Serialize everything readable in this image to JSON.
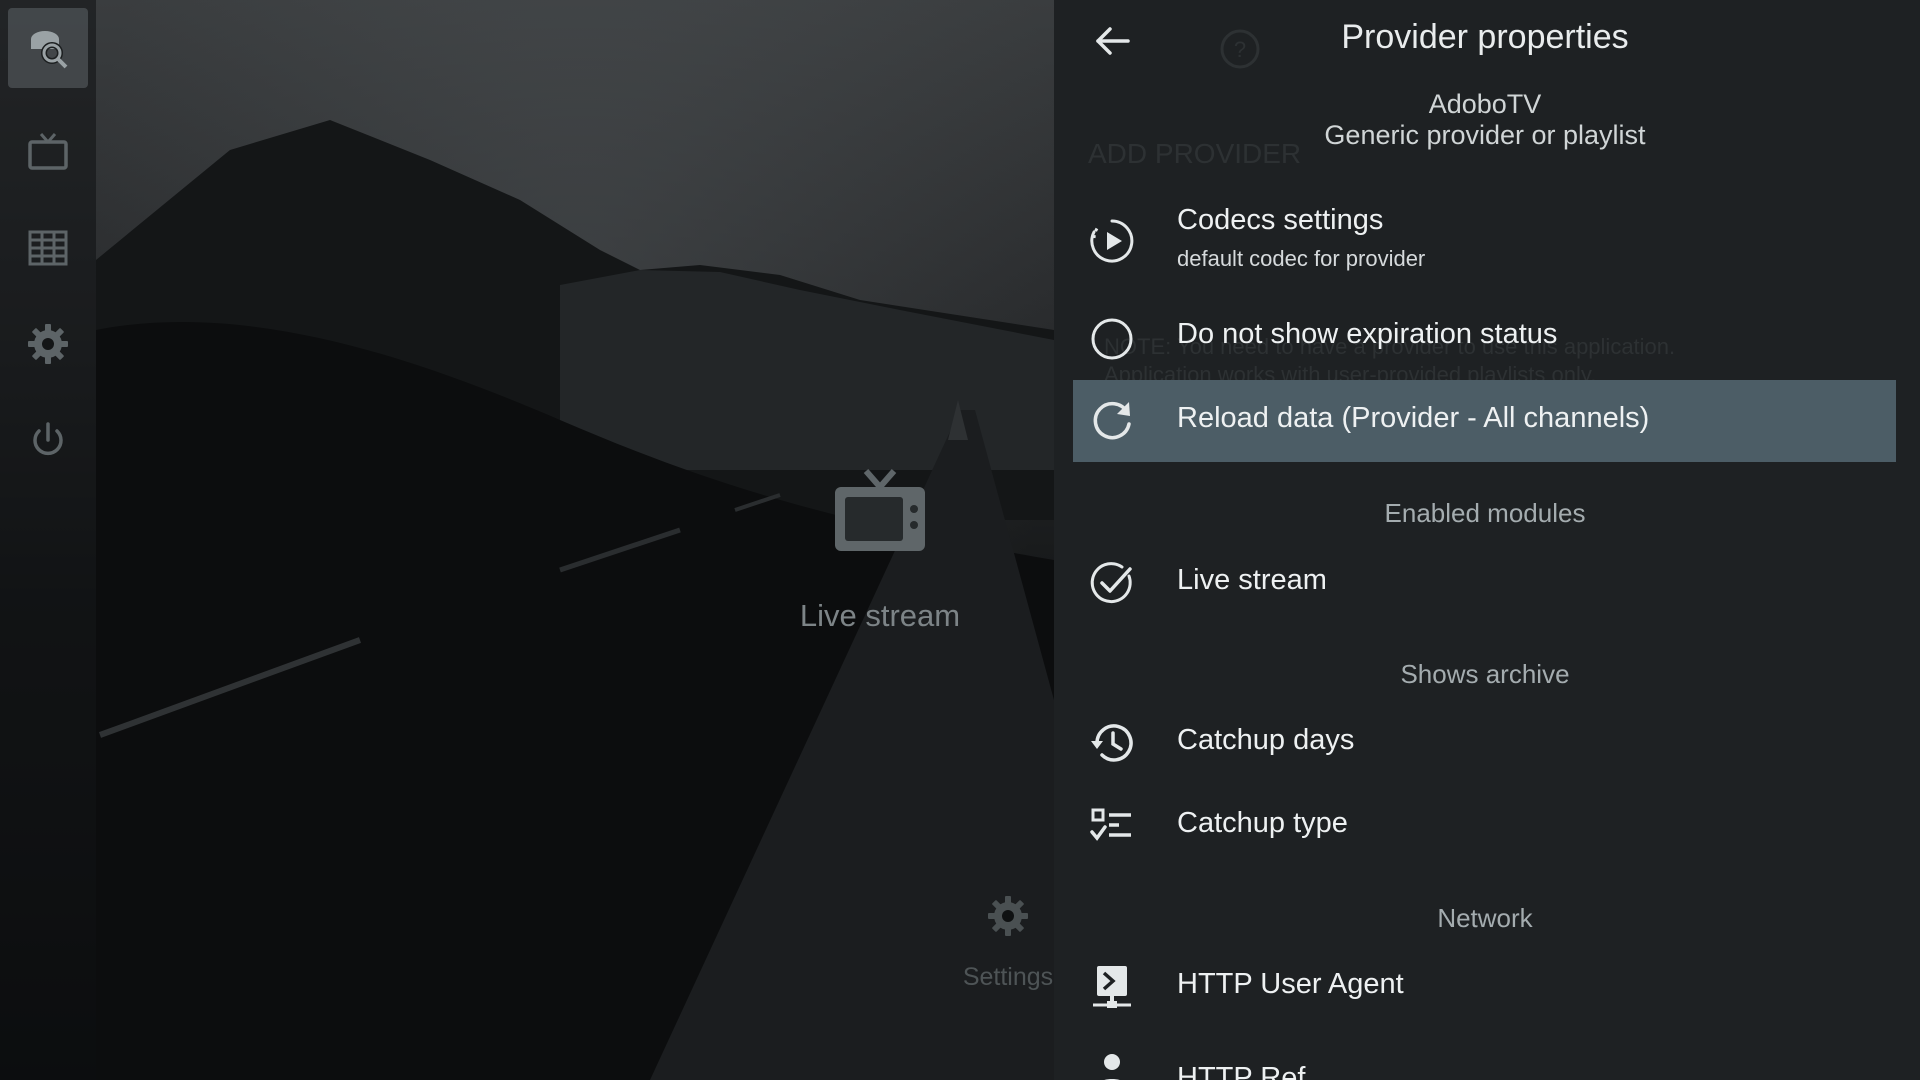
{
  "rail": {
    "items": [
      {
        "name": "search-channels",
        "icon": "search-icon",
        "active": true
      },
      {
        "name": "tv",
        "icon": "tv-icon",
        "active": false
      },
      {
        "name": "guide",
        "icon": "grid-icon",
        "active": false
      },
      {
        "name": "settings",
        "icon": "gear-icon",
        "active": false
      },
      {
        "name": "power",
        "icon": "power-icon",
        "active": false
      }
    ]
  },
  "background": {
    "feature_label": "Live stream",
    "settings_label": "Settings",
    "ghost_add_provider": "ADD PROVIDER",
    "ghost_note": "NOTE: You need to have a provider to use this application.",
    "ghost_note2": "Application works with user-provided playlists only."
  },
  "dialog": {
    "title": "Provider properties",
    "provider_name": "AdoboTV",
    "provider_type": "Generic provider or playlist",
    "rows": {
      "codecs": {
        "label": "Codecs settings",
        "sub": "default codec for provider",
        "icon": "play-circle-icon"
      },
      "expiration": {
        "label": "Do not show expiration status",
        "icon": "radio-unchecked-icon"
      },
      "reload": {
        "label": "Reload data (Provider - All channels)",
        "icon": "refresh-icon",
        "selected": true
      },
      "live_stream": {
        "label": "Live stream",
        "icon": "check-circle-icon"
      },
      "catchup_days": {
        "label": "Catchup days",
        "icon": "history-icon"
      },
      "catchup_type": {
        "label": "Catchup type",
        "icon": "list-check-icon"
      },
      "http_user_agent": {
        "label": "HTTP User Agent",
        "icon": "agent-icon"
      },
      "http_referer_partial": {
        "label": "HTTP Ref",
        "icon": "person-icon"
      }
    },
    "sections": {
      "enabled_modules": "Enabled modules",
      "shows_archive": "Shows archive",
      "network": "Network"
    }
  },
  "colors": {
    "panel_bg": "#1e2123",
    "selected_row": "#4c5d66",
    "text_primary": "#eef1f2",
    "section_header": "#a4acaf"
  }
}
